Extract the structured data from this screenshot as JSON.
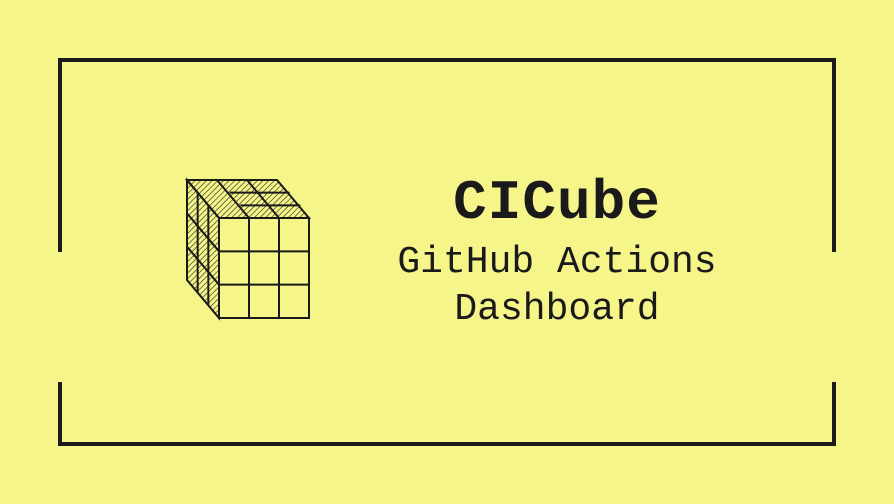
{
  "brand": {
    "title": "CICube",
    "subtitle_line1": "GitHub Actions",
    "subtitle_line2": "Dashboard"
  }
}
